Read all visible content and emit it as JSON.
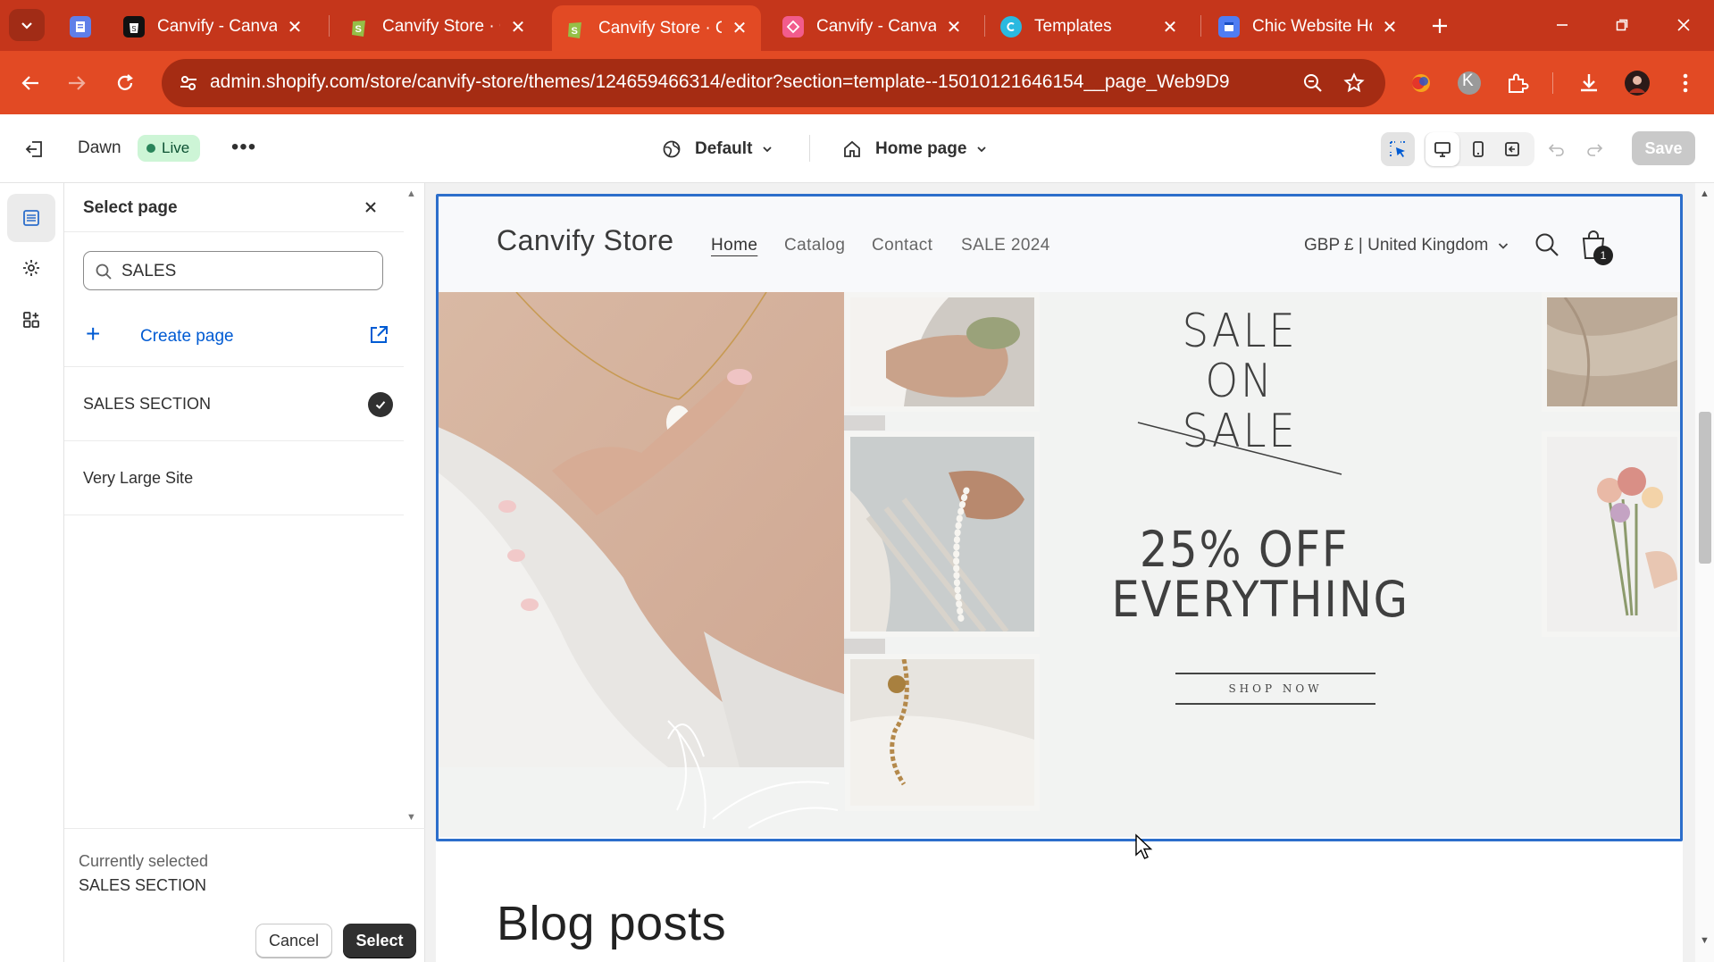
{
  "browser": {
    "tabs": [
      {
        "title": "Canvify - Canva P",
        "favicon": "shopify-dark-icon",
        "active": false
      },
      {
        "title": "Canvify Store · Ca",
        "favicon": "shopify-icon",
        "active": false
      },
      {
        "title": "Canvify Store · Cu",
        "favicon": "shopify-icon",
        "active": true
      },
      {
        "title": "Canvify - Canva t",
        "favicon": "canvify-icon",
        "active": false
      },
      {
        "title": "Templates",
        "favicon": "canva-icon",
        "active": false
      },
      {
        "title": "Chic Website Hor",
        "favicon": "docs-icon",
        "active": false
      }
    ],
    "url": "admin.shopify.com/store/canvify-store/themes/124659466314/editor?section=template--15010121646154__page_Web9D9",
    "profile_initial": "K",
    "accent": "#e24a24"
  },
  "editor": {
    "theme_name": "Dawn",
    "live_badge": "Live",
    "more": "•••",
    "template_dropdown": "Default",
    "page_dropdown": "Home page",
    "save_label": "Save"
  },
  "panel": {
    "title": "Select page",
    "search_value": "SALES",
    "create_label": "Create page",
    "pages": [
      {
        "name": "SALES SECTION",
        "selected": true
      },
      {
        "name": "Very Large Site",
        "selected": false
      }
    ],
    "currently_selected_label": "Currently selected",
    "currently_selected_value": "SALES SECTION",
    "cancel_label": "Cancel",
    "select_label": "Select"
  },
  "store": {
    "name": "Canvify Store",
    "nav": [
      "Home",
      "Catalog",
      "Contact",
      "SALE 2024"
    ],
    "currency": "GBP £ | United Kingdom",
    "cart_count": "1",
    "sale_heading_line1": "SALE ON",
    "sale_heading_line2": "SALE",
    "offer_line1": "25% OFF",
    "offer_line2": "EVERYTHING",
    "cta": "SHOP NOW",
    "blog_heading": "Blog posts"
  }
}
